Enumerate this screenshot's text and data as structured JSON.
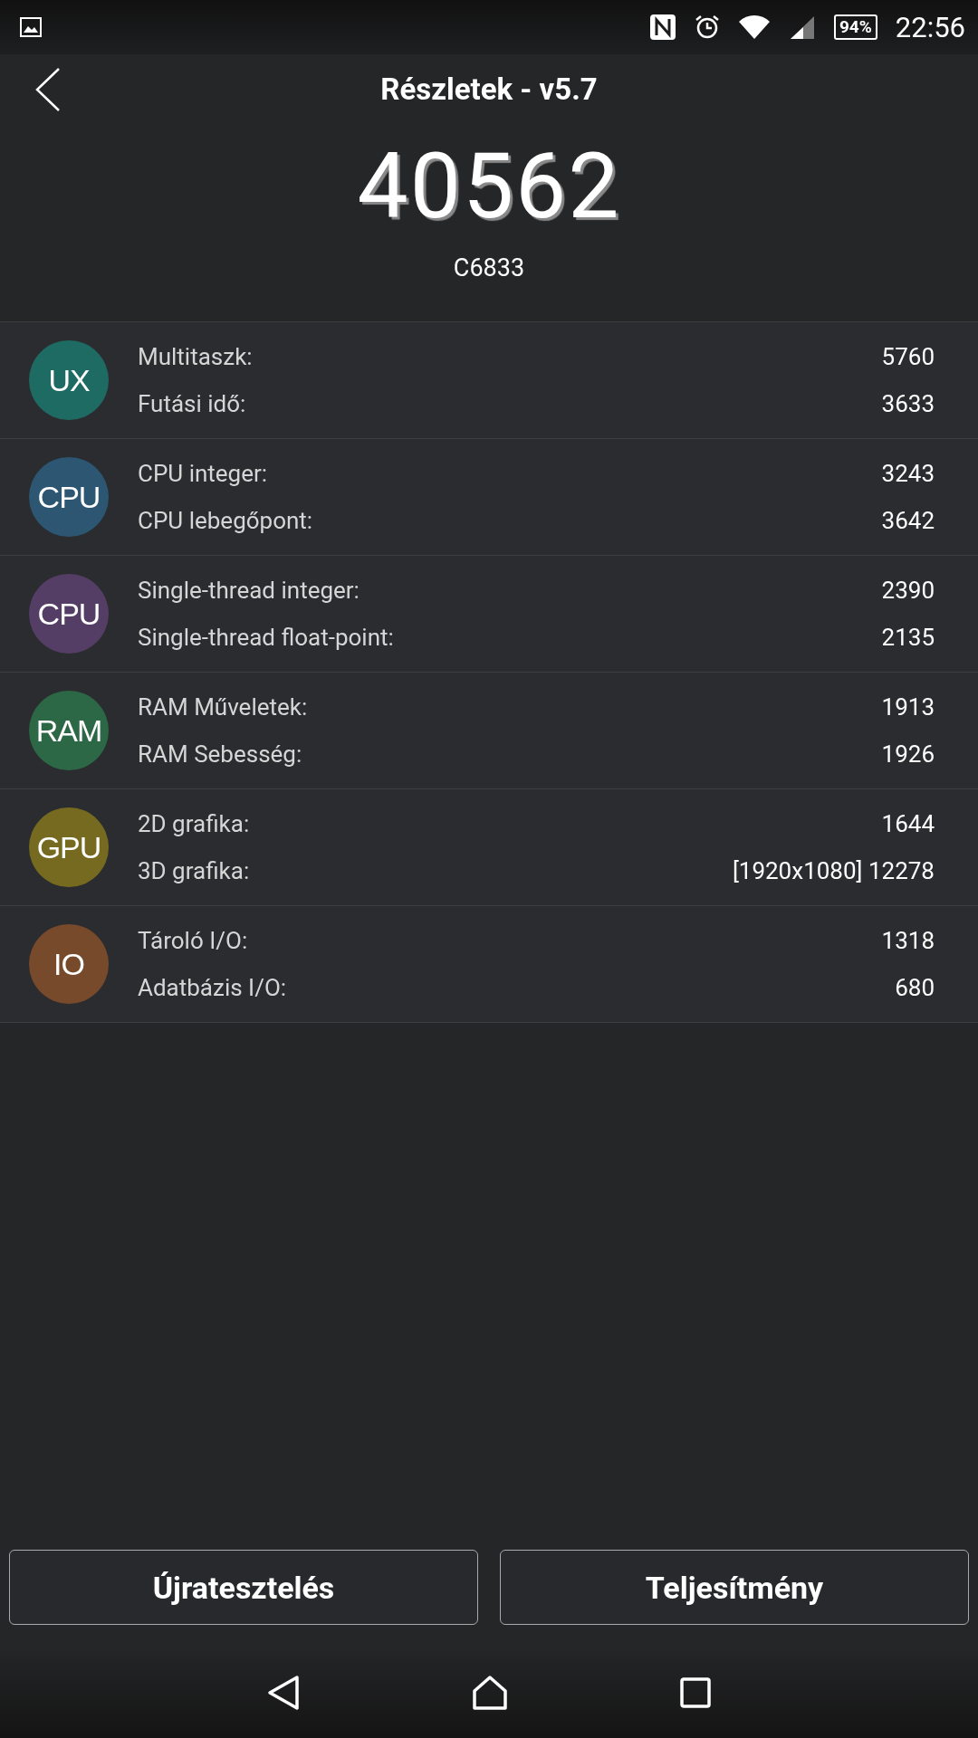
{
  "status_bar": {
    "battery": "94%",
    "time": "22:56"
  },
  "header": {
    "title": "Részletek - v5.7"
  },
  "score": {
    "value": "40562",
    "device": "C6833"
  },
  "groups": [
    {
      "badge": "UX",
      "color": "#1e6b64",
      "items": [
        {
          "label": "Multitaszk:",
          "value": "5760"
        },
        {
          "label": "Futási idő:",
          "value": "3633"
        }
      ]
    },
    {
      "badge": "CPU",
      "color": "#2d5672",
      "items": [
        {
          "label": "CPU integer:",
          "value": "3243"
        },
        {
          "label": "CPU lebegőpont:",
          "value": "3642"
        }
      ]
    },
    {
      "badge": "CPU",
      "color": "#553e66",
      "items": [
        {
          "label": "Single-thread integer:",
          "value": "2390"
        },
        {
          "label": "Single-thread float-point:",
          "value": "2135"
        }
      ]
    },
    {
      "badge": "RAM",
      "color": "#2c6845",
      "items": [
        {
          "label": "RAM Műveletek:",
          "value": "1913"
        },
        {
          "label": "RAM Sebesség:",
          "value": "1926"
        }
      ]
    },
    {
      "badge": "GPU",
      "color": "#766a20",
      "items": [
        {
          "label": "2D grafika:",
          "value": "1644"
        },
        {
          "label": "3D grafika:",
          "value": "[1920x1080] 12278"
        }
      ]
    },
    {
      "badge": "IO",
      "color": "#774a2b",
      "items": [
        {
          "label": "Tároló I/O:",
          "value": "1318"
        },
        {
          "label": "Adatbázis I/O:",
          "value": "680"
        }
      ]
    }
  ],
  "buttons": [
    "Újratesztelés",
    "Teljesítmény"
  ]
}
